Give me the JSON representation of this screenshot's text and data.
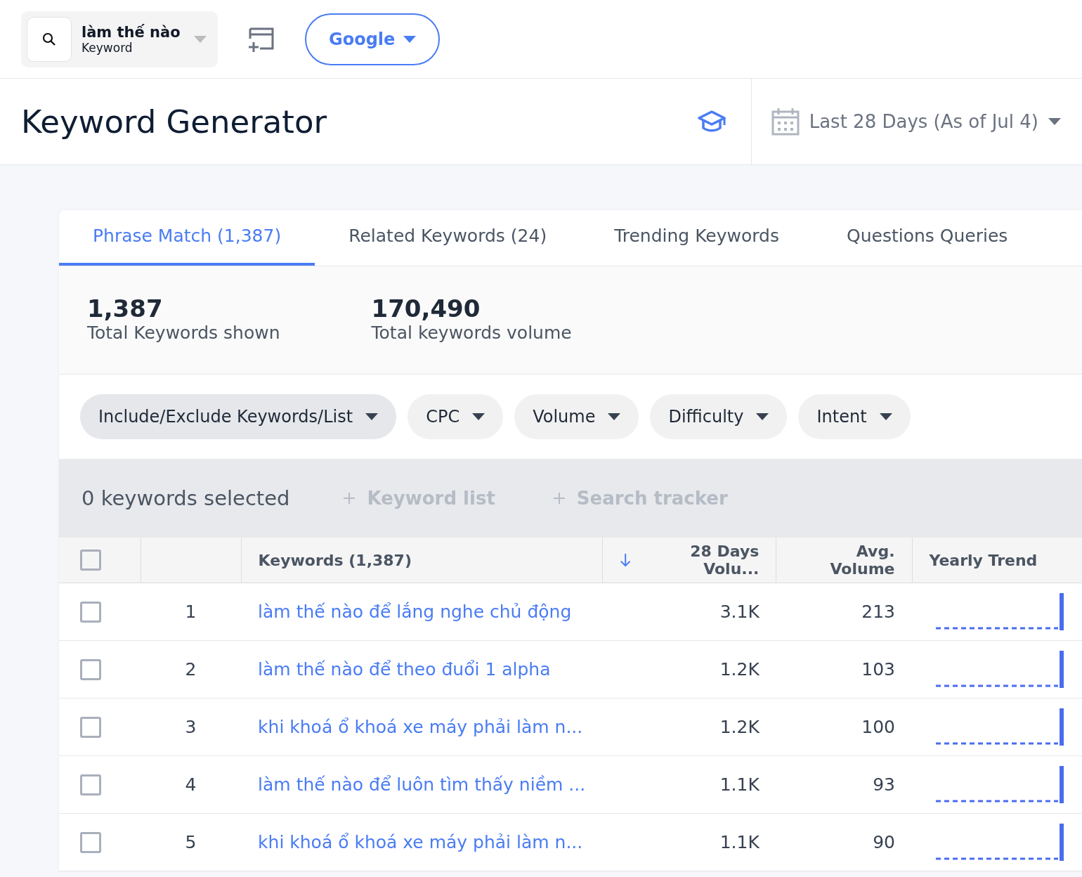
{
  "search": {
    "query": "làm thế nào",
    "type": "Keyword"
  },
  "engine": {
    "label": "Google"
  },
  "page": {
    "title": "Keyword Generator",
    "date_range": "Last 28 Days (As of Jul 4)"
  },
  "tabs": [
    {
      "label": "Phrase Match (1,387)",
      "selected": true
    },
    {
      "label": "Related Keywords (24)",
      "selected": false
    },
    {
      "label": "Trending Keywords",
      "selected": false
    },
    {
      "label": "Questions Queries",
      "selected": false
    }
  ],
  "stats": [
    {
      "value": "1,387",
      "label": "Total Keywords shown"
    },
    {
      "value": "170,490",
      "label": "Total keywords volume"
    }
  ],
  "filters": [
    {
      "label": "Include/Exclude Keywords/List",
      "active": true
    },
    {
      "label": "CPC",
      "active": false
    },
    {
      "label": "Volume",
      "active": false
    },
    {
      "label": "Difficulty",
      "active": false
    },
    {
      "label": "Intent",
      "active": false
    }
  ],
  "selection": {
    "count_text": "0 keywords selected",
    "actions": [
      "Keyword list",
      "Search tracker"
    ]
  },
  "table": {
    "select_all": false,
    "columns": [
      "Keywords (1,387)",
      "28 Days Volu...",
      "Avg. Volume",
      "Yearly Trend"
    ],
    "rows": [
      {
        "checked": false,
        "index": "1",
        "keyword": "làm thế nào để lắng nghe chủ động",
        "volume": "3.1K",
        "avg": "213"
      },
      {
        "checked": false,
        "index": "2",
        "keyword": "làm thế nào để theo đuổi 1 alpha",
        "volume": "1.2K",
        "avg": "103"
      },
      {
        "checked": false,
        "index": "3",
        "keyword": "khi khoá ổ khoá xe máy phải làm n...",
        "volume": "1.2K",
        "avg": "100"
      },
      {
        "checked": false,
        "index": "4",
        "keyword": "làm thế nào để luôn tìm thấy niềm ...",
        "volume": "1.1K",
        "avg": "93"
      },
      {
        "checked": false,
        "index": "5",
        "keyword": "khi khoá ổ khoá xe máy phải làm n...",
        "volume": "1.1K",
        "avg": "90"
      }
    ]
  }
}
